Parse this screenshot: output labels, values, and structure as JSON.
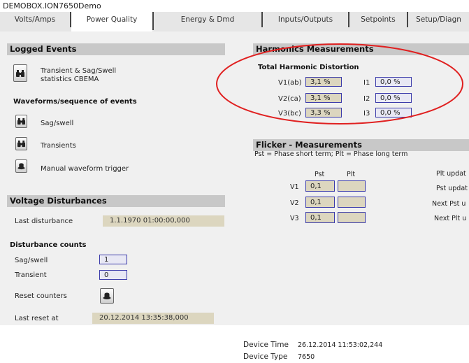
{
  "app_title": "DEMOBOX.ION7650Demo",
  "tabs": [
    {
      "label": "Volts/Amps"
    },
    {
      "label": "Power Quality"
    },
    {
      "label": "Energy & Dmd"
    },
    {
      "label": "Inputs/Outputs"
    },
    {
      "label": "Setpoints"
    },
    {
      "label": "Setup/Diagn"
    }
  ],
  "active_tab": "Power Quality",
  "logged_events": {
    "header": "Logged Events",
    "cbema_label_line1": "Transient & Sag/Swell",
    "cbema_label_line2": "statistics CBEMA",
    "waveforms_header": "Waveforms/sequence of events",
    "sag_swell_label": "Sag/swell",
    "transients_label": "Transients",
    "manual_trigger_label": "Manual waveform trigger"
  },
  "voltage_disturbances": {
    "header": "Voltage Disturbances",
    "last_disturbance_label": "Last disturbance",
    "last_disturbance_value": "1.1.1970 01:00:00,000",
    "counts_header": "Disturbance counts",
    "sag_swell_label": "Sag/swell",
    "sag_swell_count": "1",
    "transient_label": "Transient",
    "transient_count": "0",
    "reset_label": "Reset counters",
    "last_reset_label": "Last reset at",
    "last_reset_value": "20.12.2014 13:35:38,000"
  },
  "harmonics": {
    "header": "Harmonics Measurements",
    "thd_header": "Total Harmonic Distortion",
    "rows": [
      {
        "v_label": "V1(ab)",
        "v_value": "3,1 %",
        "i_label": "I1",
        "i_value": "0,0 %"
      },
      {
        "v_label": "V2(ca)",
        "v_value": "3,1 %",
        "i_label": "I2",
        "i_value": "0,0 %"
      },
      {
        "v_label": "V3(bc)",
        "v_value": "3,3 %",
        "i_label": "I3",
        "i_value": "0,0 %"
      }
    ]
  },
  "flicker": {
    "header": "Flicker - Measurements",
    "subtitle": "Pst = Phase short term; Plt = Phase long term",
    "col_pst": "Pst",
    "col_plt": "Plt",
    "rows": [
      {
        "label": "V1",
        "pst": "0,1",
        "plt": ""
      },
      {
        "label": "V2",
        "pst": "0,1",
        "plt": ""
      },
      {
        "label": "V3",
        "pst": "0,1",
        "plt": ""
      }
    ],
    "right_labels": [
      "Plt updat",
      "Pst updat",
      "Next Pst u",
      "Next Plt u"
    ]
  },
  "footer": {
    "device_time_label": "Device Time",
    "device_time_value": "26.12.2014 11:53:02,244",
    "device_type_label": "Device Type",
    "device_type_value": "7650"
  },
  "colors": {
    "header_bg": "#c8c8c8",
    "panel_bg": "#f0f0f0",
    "value_bg": "#dcd6bf",
    "value_border": "#3b3baa",
    "annotation": "#e02020"
  }
}
